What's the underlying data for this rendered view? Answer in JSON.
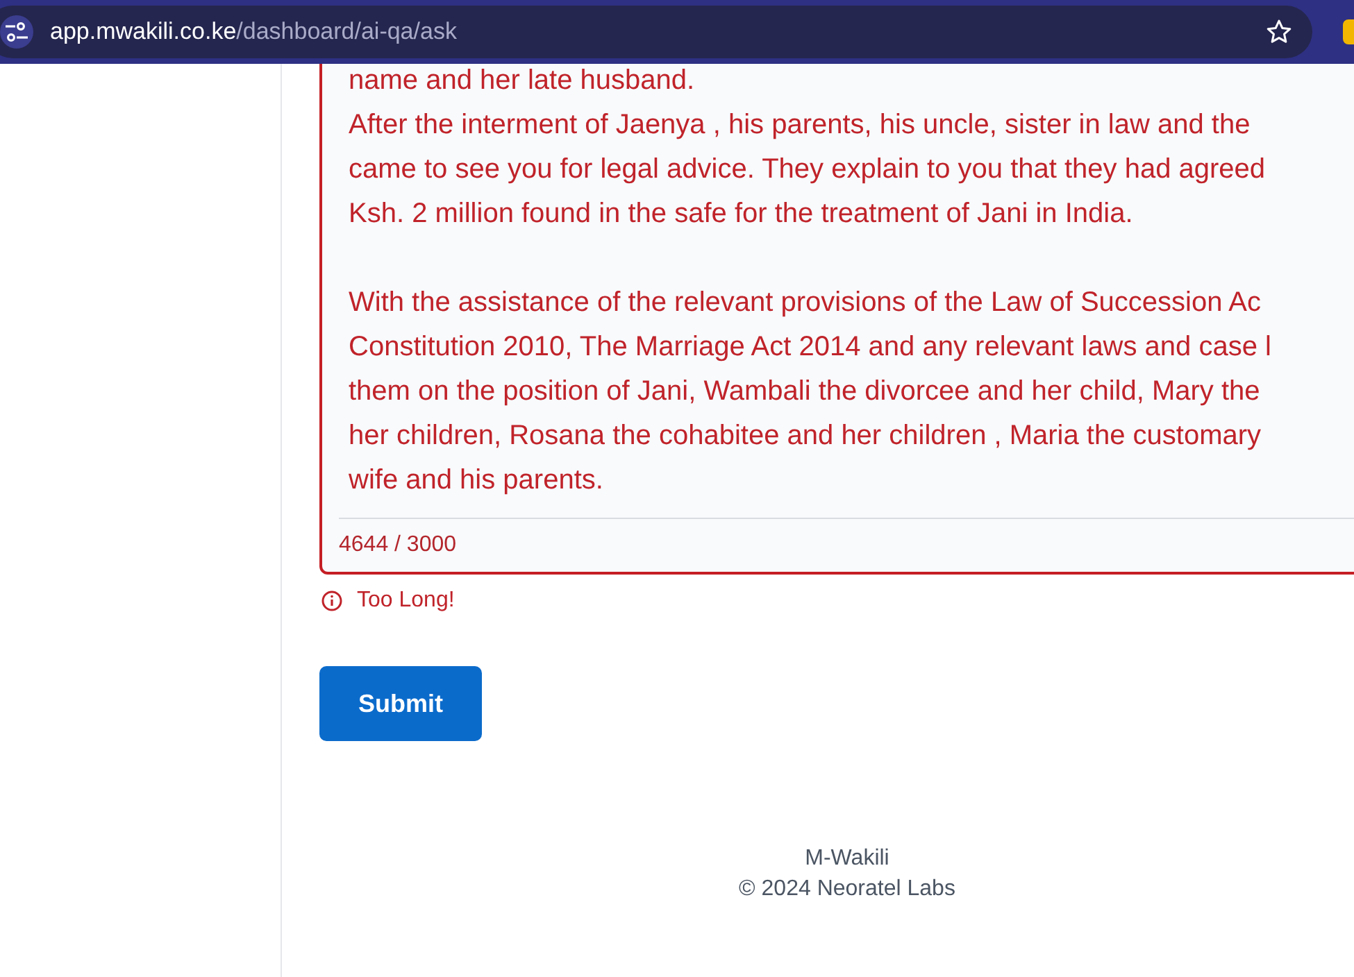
{
  "browser": {
    "url_host": "app.mwakili.co.ke",
    "url_path": "/dashboard/ai-qa/ask"
  },
  "question": {
    "paragraphs": [
      [
        "name and her late husband.",
        "After the interment of Jaenya , his parents, his uncle, sister in law and the",
        "came to see you for legal advice. They explain to you that they had agreed",
        "Ksh. 2 million found in the safe for the treatment of Jani in India."
      ],
      [
        "With the assistance of the relevant provisions of the Law of Succession Ac",
        "Constitution 2010, The Marriage Act 2014 and any relevant laws and case l",
        "them on the position of Jani, Wambali the divorcee and her child, Mary the",
        "her children, Rosana the cohabitee and her children , Maria the customary",
        "wife and his parents."
      ]
    ],
    "counter": "4644 / 3000",
    "error": true,
    "error_text": "Too Long!"
  },
  "submit_button": "Submit",
  "footer": {
    "brand": "M-Wakili",
    "copyright": "© 2024 Neoratel Labs"
  }
}
